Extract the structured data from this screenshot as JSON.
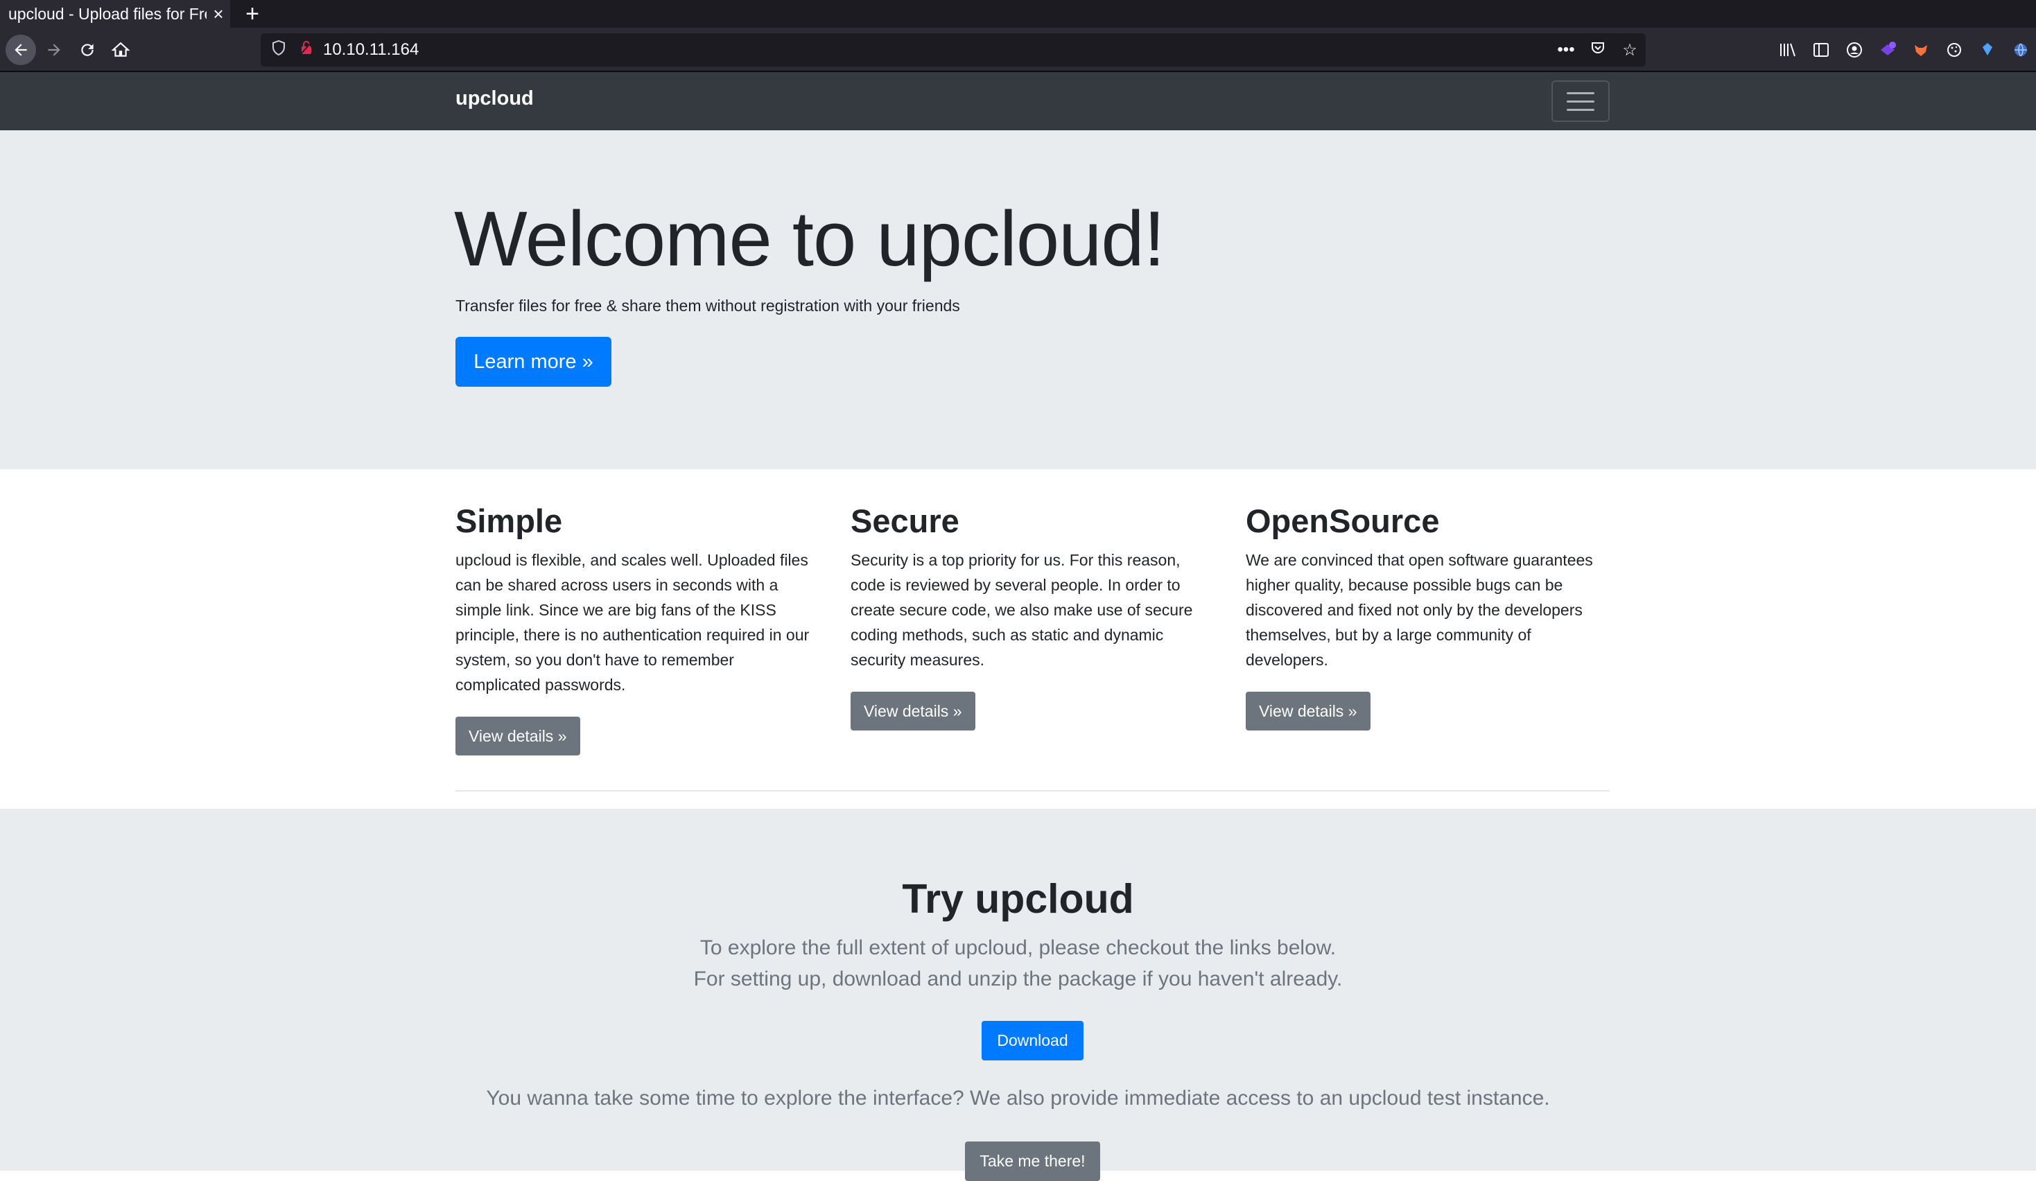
{
  "browser": {
    "tab_title": "upcloud - Upload files for Free!",
    "url": "10.10.11.164",
    "new_tab": "+",
    "close_tab": "×"
  },
  "navbar": {
    "brand": "upcloud"
  },
  "jumbotron": {
    "heading": "Welcome to upcloud!",
    "subtitle": "Transfer files for free & share them without registration with your friends",
    "learn_more": "Learn more »"
  },
  "features": [
    {
      "title": "Simple",
      "text": "upcloud is flexible, and scales well. Uploaded files can be shared across users in seconds with a simple link. Since we are big fans of the KISS principle, there is no authentication required in our system, so you don't have to remember complicated passwords.",
      "button": "View details »"
    },
    {
      "title": "Secure",
      "text": "Security is a top priority for us. For this reason, code is reviewed by several people. In order to create secure code, we also make use of secure coding methods, such as static and dynamic security measures.",
      "button": "View details »"
    },
    {
      "title": "OpenSource",
      "text": "We are convinced that open software guarantees higher quality, because possible bugs can be discovered and fixed not only by the developers themselves, but by a large community of developers.",
      "button": "View details »"
    }
  ],
  "try_section": {
    "heading": "Try upcloud",
    "line1": "To explore the full extent of upcloud, please checkout the links below.",
    "line2": "For setting up, download and unzip the package if you haven't already.",
    "download": "Download",
    "line3": "You wanna take some time to explore the interface? We also provide immediate access to an upcloud test instance.",
    "take_me": "Take me there!"
  }
}
